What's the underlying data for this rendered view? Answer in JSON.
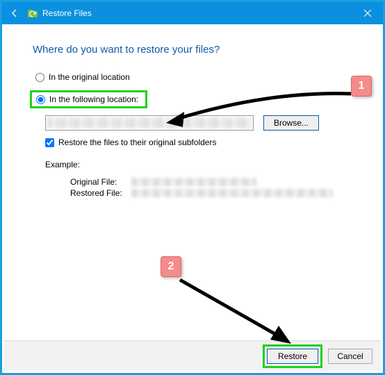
{
  "titlebar": {
    "title": "Restore Files"
  },
  "heading": "Where do you want to restore your files?",
  "options": {
    "original": "In the original location",
    "following": "In the following location:"
  },
  "browse_label": "Browse...",
  "checkbox_label": "Restore the files to their original subfolders",
  "example": {
    "heading": "Example:",
    "original_key": "Original File:",
    "restored_key": "Restored File:"
  },
  "footer": {
    "restore": "Restore",
    "cancel": "Cancel"
  },
  "callouts": {
    "one": "1",
    "two": "2"
  }
}
